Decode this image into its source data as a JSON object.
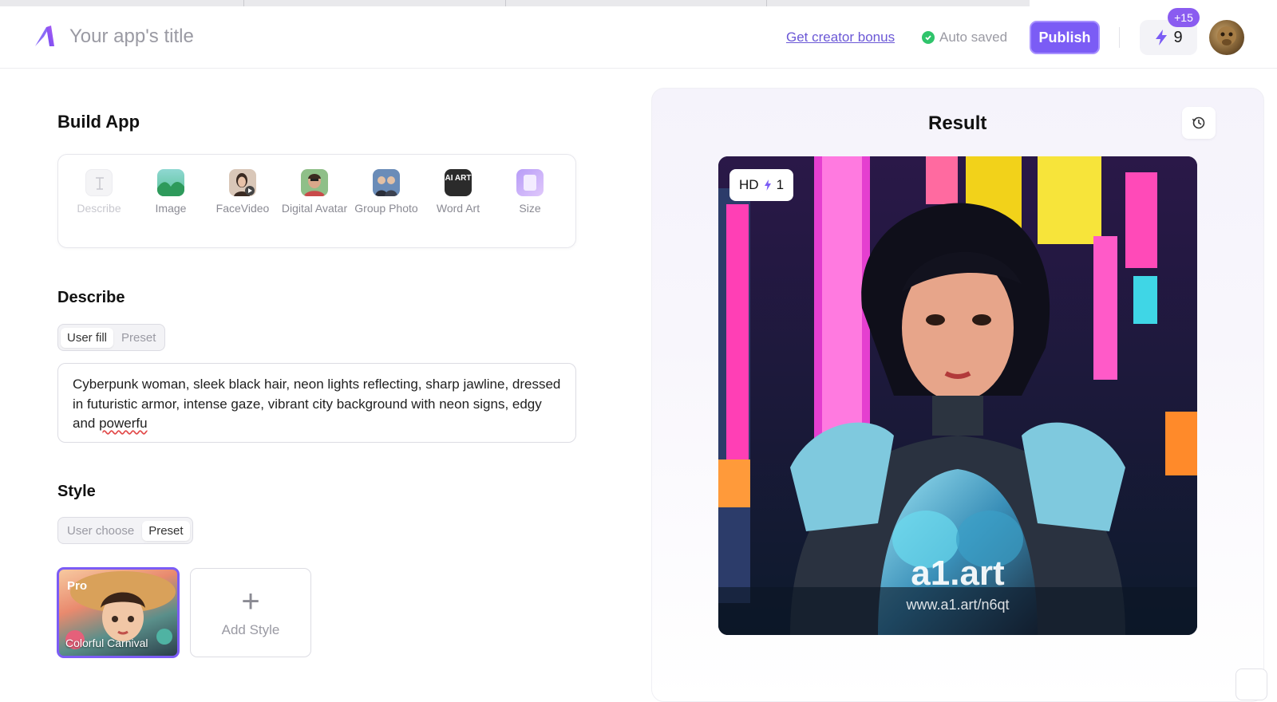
{
  "header": {
    "app_title_placeholder": "Your app's title",
    "creator_bonus": "Get creator bonus",
    "auto_saved": "Auto saved",
    "publish": "Publish",
    "credits": "9",
    "credits_bonus": "+15"
  },
  "build": {
    "title": "Build App",
    "tools": [
      {
        "label": "Describe",
        "disabled": true
      },
      {
        "label": "Image"
      },
      {
        "label": "FaceVideo"
      },
      {
        "label": "Digital Avatar"
      },
      {
        "label": "Group Photo"
      },
      {
        "label": "Word Art"
      },
      {
        "label": "Size"
      }
    ],
    "word_art_icon_text": "AI ART"
  },
  "describe": {
    "title": "Describe",
    "mode_user": "User fill",
    "mode_preset": "Preset",
    "prompt_main": "Cyberpunk woman, sleek black hair, neon lights reflecting, sharp jawline, dressed in futuristic armor, intense gaze, vibrant city background with neon signs, edgy and ",
    "prompt_misspelled": "powerfu"
  },
  "style": {
    "title": "Style",
    "mode_user": "User choose",
    "mode_preset": "Preset",
    "card_badge": "Pro",
    "card_label": "Colorful Carnival",
    "add_style": "Add Style"
  },
  "result": {
    "title": "Result",
    "hd": "HD",
    "hd_cost": "1",
    "watermark_brand": "a1.art",
    "watermark_url": "www.a1.art/n6qt"
  },
  "colors": {
    "accent": "#7b5cf5",
    "success": "#2fc46b",
    "link": "#6b58d6"
  }
}
